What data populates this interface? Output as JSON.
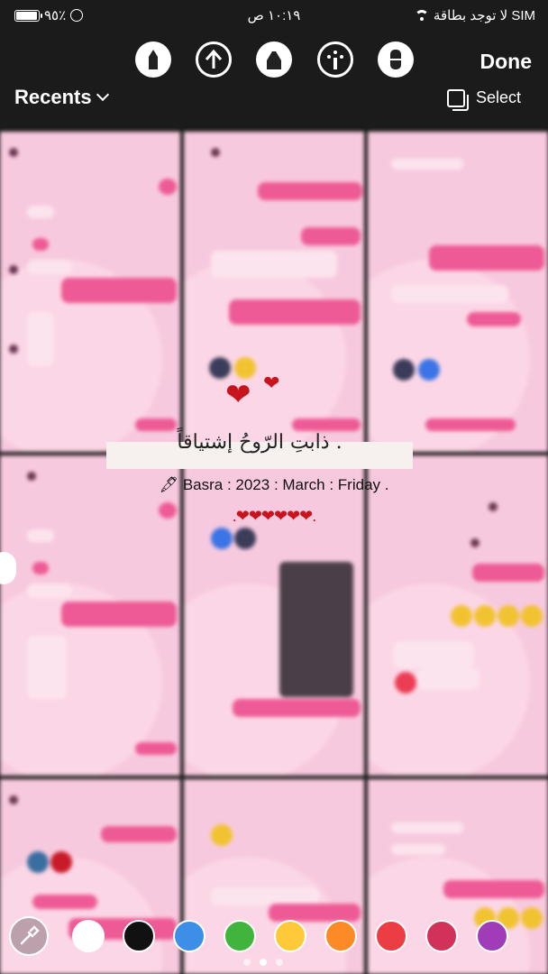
{
  "status_bar": {
    "battery_percent": "٩٥٪",
    "battery_level": 0.95,
    "time": "١٠:١٩ ص",
    "carrier": "لا توجد بطاقة SIM"
  },
  "toolbar": {
    "tools": [
      {
        "icon": "pen-tool-icon"
      },
      {
        "icon": "arrow-pen-icon"
      },
      {
        "icon": "marker-icon"
      },
      {
        "icon": "glow-pen-icon"
      },
      {
        "icon": "eraser-icon"
      }
    ],
    "done_label": "Done",
    "recents_label": "Recents",
    "select_label": "Select"
  },
  "overlay": {
    "arabic_text": "ذابتِ الرّوحُ إشتياقاً .",
    "caption": "🖋 Basra : 2023 : March : Friday .",
    "hearts_line": ".❤❤❤❤❤❤."
  },
  "palette": {
    "colors": [
      "#ffffff",
      "#111111",
      "#3d8ee6",
      "#41b43e",
      "#ffc93a",
      "#fc8a26",
      "#ec3d45",
      "#d2325a",
      "#a13cb8"
    ]
  },
  "pager": {
    "pages": 3,
    "active": 1
  }
}
